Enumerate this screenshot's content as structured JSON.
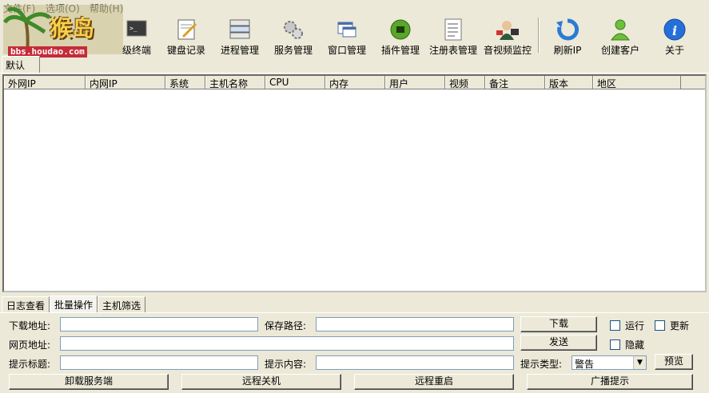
{
  "menu": {
    "items": [
      "文件(F)",
      "选项(O)",
      "帮助(H)"
    ]
  },
  "logo": {
    "text": "猴岛",
    "url": "bbs.houdao.com"
  },
  "toolbar": [
    {
      "label": "级终端",
      "icon": "terminal-icon"
    },
    {
      "label": "键盘记录",
      "icon": "keyboard-log-icon"
    },
    {
      "label": "进程管理",
      "icon": "process-icon"
    },
    {
      "label": "服务管理",
      "icon": "service-gear-icon"
    },
    {
      "label": "窗口管理",
      "icon": "window-icon"
    },
    {
      "label": "插件管理",
      "icon": "plugin-icon"
    },
    {
      "label": "注册表管理",
      "icon": "registry-icon"
    },
    {
      "label": "音视频监控",
      "icon": "av-monitor-icon"
    },
    {
      "label": "刷新IP",
      "icon": "refresh-icon"
    },
    {
      "label": "创建客户",
      "icon": "create-client-icon"
    },
    {
      "label": "关于",
      "icon": "info-icon"
    }
  ],
  "group_tab": "默认",
  "columns": [
    "外网IP",
    "内网IP",
    "系统",
    "主机名称",
    "CPU",
    "内存",
    "用户",
    "视频",
    "备注",
    "版本",
    "地区"
  ],
  "bottom_tabs": [
    "日志查看",
    "批量操作",
    "主机筛选"
  ],
  "form": {
    "download_label": "下载地址:",
    "save_path_label": "保存路径:",
    "web_label": "网页地址:",
    "tip_title_label": "提示标题:",
    "tip_content_label": "提示内容:",
    "tip_type_label": "提示类型:",
    "download_value": "",
    "save_path_value": "",
    "web_value": "",
    "tip_title_value": "",
    "tip_content_value": "",
    "tip_type_value": "警告"
  },
  "buttons": {
    "download": "下载",
    "send": "发送",
    "preview": "预览",
    "uninstall": "卸载服务端",
    "shutdown": "远程关机",
    "reboot": "远程重启",
    "broadcast": "广播提示"
  },
  "checkboxes": {
    "run": "运行",
    "update": "更新",
    "hide": "隐藏"
  },
  "colors": {
    "window_bg": "#ece9d8",
    "field_border": "#7f9db9",
    "logo_bar": "#c62b3a"
  }
}
